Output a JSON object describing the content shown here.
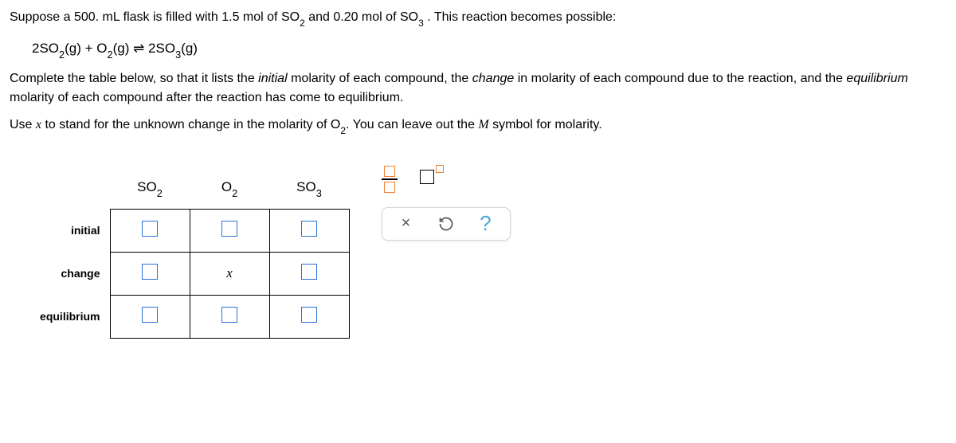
{
  "problem": {
    "line1_a": "Suppose a ",
    "line1_b": " flask is filled with ",
    "line1_c": " of ",
    "line1_d": " and ",
    "line1_e": " of ",
    "line1_f": ". This reaction becomes possible:",
    "volume": "500. mL",
    "mol1": "1.5 mol",
    "species1": "SO",
    "species1_sub": "2",
    "mol2": "0.20 mol",
    "species2": "SO",
    "species2_sub": "3"
  },
  "equation": {
    "c1": "2SO",
    "s1": "2",
    "g1": "(g) + O",
    "s2": "2",
    "g2": "(g) ⇌ 2SO",
    "s3": "3",
    "g3": "(g)"
  },
  "instr1_a": "Complete the table below, so that it lists the ",
  "instr1_b": " molarity of each compound, the ",
  "instr1_c": " in molarity of each compound due to the reaction, and the ",
  "instr1_d": " molarity of each compound after the reaction has come to equilibrium.",
  "i_initial": "initial",
  "i_change": "change",
  "i_equilibrium": "equilibrium",
  "instr2_a": "Use ",
  "instr2_x": "x",
  "instr2_b": " to stand for the unknown change in the molarity of ",
  "instr2_sp": "O",
  "instr2_sub": "2",
  "instr2_c": ". You can leave out the ",
  "instr2_m": "M",
  "instr2_d": " symbol for molarity.",
  "table": {
    "col1": "SO",
    "col1_sub": "2",
    "col2": "O",
    "col2_sub": "2",
    "col3": "SO",
    "col3_sub": "3",
    "row1": "initial",
    "row2": "change",
    "row3": "equilibrium",
    "change_o2": "x"
  },
  "tools": {
    "close": "×",
    "help": "?"
  }
}
